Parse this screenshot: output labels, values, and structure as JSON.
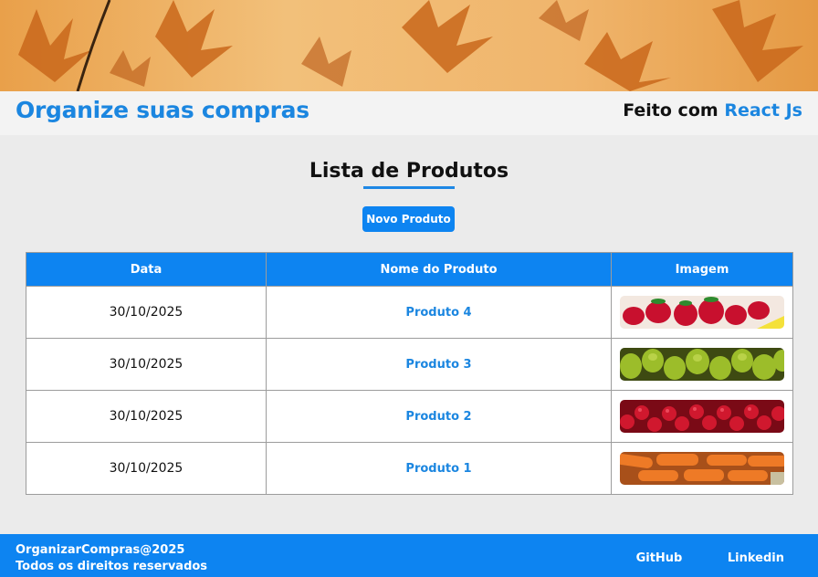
{
  "header": {
    "title": "Organize suas compras",
    "made_with_prefix": "Feito com",
    "made_with_tech": "React Js"
  },
  "main": {
    "title": "Lista de Produtos",
    "new_button": "Novo Produto",
    "table": {
      "columns": [
        "Data",
        "Nome do Produto",
        "Imagem"
      ],
      "rows": [
        {
          "date": "30/10/2025",
          "name": "Produto 4",
          "image": "strawberries"
        },
        {
          "date": "30/10/2025",
          "name": "Produto 3",
          "image": "pears"
        },
        {
          "date": "30/10/2025",
          "name": "Produto 2",
          "image": "cherries"
        },
        {
          "date": "30/10/2025",
          "name": "Produto 1",
          "image": "carrots"
        }
      ]
    }
  },
  "footer": {
    "copyright": "OrganizarCompras@2025",
    "rights": "Todos os direitos reservados",
    "links": [
      "GitHub",
      "Linkedin"
    ]
  },
  "colors": {
    "accent": "#0d84f1",
    "title_blue": "#1b86e0"
  }
}
